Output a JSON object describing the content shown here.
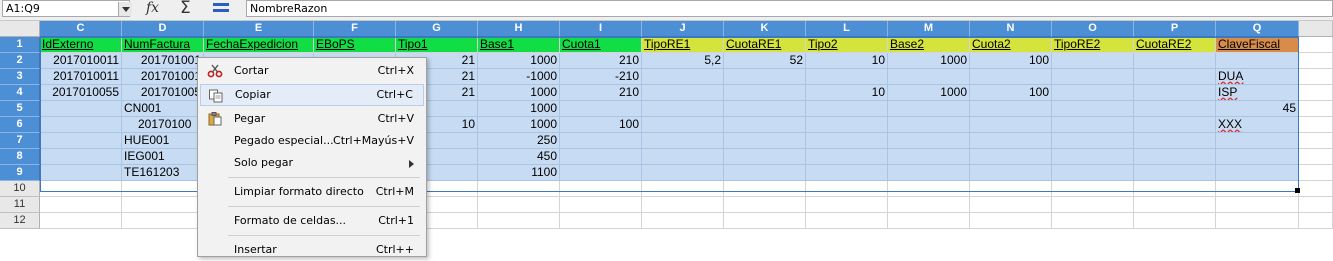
{
  "formula_bar": {
    "name_box": "A1:Q9",
    "formula": "NombreRazon",
    "icons": [
      "function-wizard-icon",
      "sum-icon",
      "formula-icon"
    ]
  },
  "columns": [
    "C",
    "D",
    "E",
    "F",
    "G",
    "H",
    "I",
    "J",
    "K",
    "L",
    "M",
    "N",
    "O",
    "P",
    "Q"
  ],
  "row_numbers": [
    "1",
    "2",
    "3",
    "4",
    "5",
    "6",
    "7",
    "8",
    "9",
    "10",
    "11",
    "12"
  ],
  "header_row": [
    "IdExterno",
    "NumFactura",
    "FechaExpedicion",
    "EBoPS",
    "Tipo1",
    "Base1",
    "Cuota1",
    "TipoRE1",
    "CuotaRE1",
    "Tipo2",
    "Base2",
    "Cuota2",
    "TipoRE2",
    "CuotaRE2",
    "ClaveFiscal"
  ],
  "rows": [
    [
      "2017010011",
      "201701001",
      "",
      "",
      "21",
      "1000",
      "210",
      "5,2",
      "52",
      "10",
      "1000",
      "100",
      "",
      "",
      ""
    ],
    [
      "2017010011",
      "201701001",
      "",
      "",
      "21",
      "-1000",
      "-210",
      "",
      "",
      "",
      "",
      "",
      "",
      "",
      "DUA"
    ],
    [
      "2017010055",
      "201701005",
      "",
      "",
      "21",
      "1000",
      "210",
      "",
      "",
      "10",
      "1000",
      "100",
      "",
      "",
      "ISP"
    ],
    [
      "",
      "CN001",
      "",
      "",
      "",
      "1000",
      "",
      "",
      "",
      "",
      "",
      "",
      "",
      "",
      "45"
    ],
    [
      "",
      "20170100",
      "",
      "",
      "10",
      "1000",
      "100",
      "",
      "",
      "",
      "",
      "",
      "",
      "",
      "XXX"
    ],
    [
      "",
      "HUE001",
      "",
      "",
      "",
      "250",
      "",
      "",
      "",
      "",
      "",
      "",
      "",
      "",
      ""
    ],
    [
      "",
      "IEG001",
      "",
      "",
      "",
      "450",
      "",
      "",
      "",
      "",
      "",
      "",
      "",
      "",
      ""
    ],
    [
      "",
      "TE161203",
      "",
      "",
      "",
      "1100",
      "",
      "",
      "",
      "",
      "",
      "",
      "",
      "",
      ""
    ]
  ],
  "header_colors": {
    "green": "#11dd44",
    "lime": "#d4e43c",
    "orange": "#d98c4a",
    "selection": "#c7dcf3",
    "header_blue": "#4c8fd5"
  },
  "context_menu": {
    "items": [
      {
        "label": "Cortar",
        "shortcut": "Ctrl+X",
        "icon": "scissors-icon"
      },
      {
        "label": "Copiar",
        "shortcut": "Ctrl+C",
        "icon": "copy-icon"
      },
      {
        "label": "Pegar",
        "shortcut": "Ctrl+V",
        "icon": "paste-icon"
      },
      {
        "label": "Pegado especial...",
        "shortcut": "Ctrl+Mayús+V",
        "icon": ""
      },
      {
        "label": "Solo pegar",
        "shortcut": "",
        "icon": "submenu-arrow-icon"
      },
      {
        "label": "Limpiar formato directo",
        "shortcut": "Ctrl+M",
        "icon": ""
      },
      {
        "label": "Formato de celdas...",
        "shortcut": "Ctrl+1",
        "icon": ""
      },
      {
        "label": "Insertar",
        "shortcut": "Ctrl++",
        "icon": ""
      }
    ]
  }
}
